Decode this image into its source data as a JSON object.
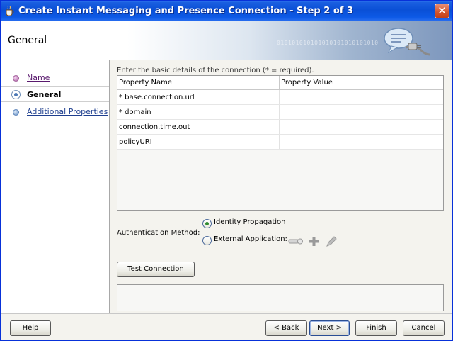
{
  "window": {
    "title": "Create Instant Messaging and Presence Connection - Step 2 of 3",
    "close_label": "✕"
  },
  "header": {
    "title": "General",
    "decoration_text": "010101010101010101010101010"
  },
  "nav": {
    "items": [
      {
        "label": "Name",
        "state": "visited"
      },
      {
        "label": "General",
        "state": "current"
      },
      {
        "label": "Additional Properties",
        "state": "pending"
      }
    ]
  },
  "content": {
    "intro": "Enter the basic details of the connection (* = required).",
    "table": {
      "columns": [
        "Property Name",
        "Property Value"
      ],
      "rows": [
        {
          "name": "* base.connection.url",
          "value": ""
        },
        {
          "name": "* domain",
          "value": ""
        },
        {
          "name": "connection.time.out",
          "value": ""
        },
        {
          "name": "policyURI",
          "value": ""
        }
      ]
    },
    "auth": {
      "label": "Authentication Method:",
      "options": [
        {
          "label": "Identity Propagation",
          "checked": true
        },
        {
          "label": "External Application:",
          "checked": false
        }
      ],
      "icons": [
        "key-icon",
        "add-icon",
        "edit-icon"
      ]
    },
    "test_button": "Test Connection"
  },
  "footer": {
    "help": "Help",
    "back": "< Back",
    "next": "Next >",
    "finish": "Finish",
    "cancel": "Cancel"
  },
  "colors": {
    "titlebar": "#0a4fd6",
    "visited_link": "#5a1a6e",
    "link": "#1f3f8f",
    "radio_selected": "#2f8b2f"
  }
}
